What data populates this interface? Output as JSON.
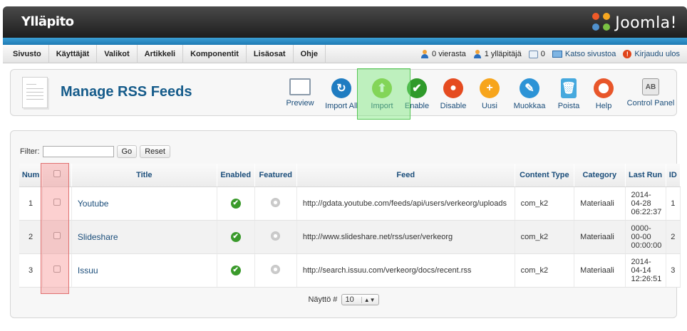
{
  "header": {
    "title": "Ylläpito",
    "brand": "Joomla!"
  },
  "menu": [
    "Sivusto",
    "Käyttäjät",
    "Valikot",
    "Artikkeli",
    "Komponentit",
    "Lisäosat",
    "Ohje"
  ],
  "status": {
    "visitors": "0 vierasta",
    "admins": "1 ylläpitäjä",
    "messages": "0",
    "view_site": "Katso sivustoa",
    "logout": "Kirjaudu ulos"
  },
  "page": {
    "title": "Manage RSS Feeds"
  },
  "toolbar": {
    "preview": "Preview",
    "import_all": "Import All",
    "import": "Import",
    "enable": "Enable",
    "disable": "Disable",
    "new": "Uusi",
    "edit": "Muokkaa",
    "delete": "Poista",
    "help": "Help",
    "control_panel": "Control Panel"
  },
  "filter": {
    "label": "Filter:",
    "value": "",
    "go": "Go",
    "reset": "Reset"
  },
  "table": {
    "headers": {
      "num": "Num",
      "title": "Title",
      "enabled": "Enabled",
      "featured": "Featured",
      "feed": "Feed",
      "content_type": "Content Type",
      "category": "Category",
      "last_run": "Last Run",
      "id": "ID"
    },
    "rows": [
      {
        "num": "1",
        "title": "Youtube",
        "feed": "http://gdata.youtube.com/feeds/api/users/verkeorg/uploads",
        "content_type": "com_k2",
        "category": "Materiaali",
        "last_run_1": "2014-",
        "last_run_2": "04-28",
        "last_run_3": "06:22:37",
        "id": "1"
      },
      {
        "num": "2",
        "title": "Slideshare",
        "feed": "http://www.slideshare.net/rss/user/verkeorg",
        "content_type": "com_k2",
        "category": "Materiaali",
        "last_run_1": "0000-",
        "last_run_2": "00-00",
        "last_run_3": "00:00:00",
        "id": "2"
      },
      {
        "num": "3",
        "title": "Issuu",
        "feed": "http://search.issuu.com/verkeorg/docs/recent.rss",
        "content_type": "com_k2",
        "category": "Materiaali",
        "last_run_1": "2014-",
        "last_run_2": "04-14",
        "last_run_3": "12:26:51",
        "id": "3"
      }
    ]
  },
  "pager": {
    "label": "Näyttö #",
    "value": "10"
  }
}
